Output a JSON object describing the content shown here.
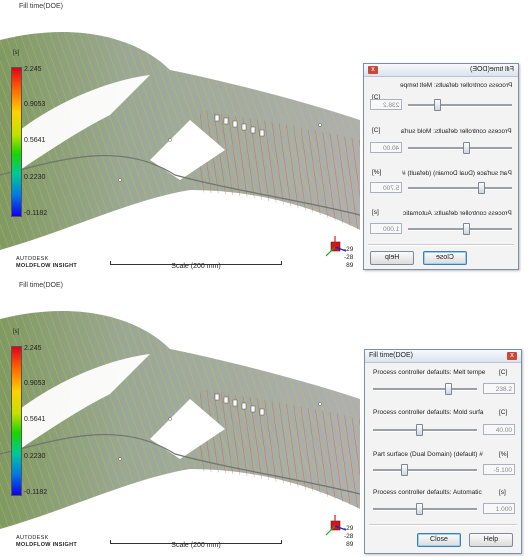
{
  "view": {
    "title": "Fill time(DOE)",
    "legend": {
      "unit": "[s]",
      "labels": [
        "2.245",
        "0.9053",
        "0.5641",
        "0.2230",
        "-0.1182"
      ]
    },
    "brand": {
      "line1": "AUTODESK",
      "line2": "MOLDFLOW INSIGHT"
    },
    "scale_label": "Scale (200 mm)",
    "coords": [
      "-29",
      "-28",
      "89"
    ]
  },
  "dialog": {
    "title": "Fill time(DOE)",
    "close_glyph": "x",
    "params": [
      {
        "label": "Process controller defaults: Melt tempe",
        "unit": "[C]",
        "value": "238.2",
        "slider_fraction": 0.72
      },
      {
        "label": "Process controller defaults: Mold surfa",
        "unit": "[C]",
        "value": "40.00",
        "slider_fraction": 0.44
      },
      {
        "label": "Part surface (Dual Domain) (default) #",
        "unit": "[%]",
        "value": "-5.100",
        "slider_fraction": 0.3
      },
      {
        "label": "Process controller defaults: Automatic",
        "unit": "[s]",
        "value": "1.000",
        "slider_fraction": 0.44
      }
    ],
    "close_label": "Close",
    "help_label": "Help"
  },
  "top_dialog_mirrored": {
    "params": [
      {
        "label": "Process controller defaults: Melt tempe",
        "unit": "[C]",
        "value": "238.2",
        "slider_fraction": 0.72
      },
      {
        "label": "Process controller defaults: Mold surfa",
        "unit": "[C]",
        "value": "40.00",
        "slider_fraction": 0.44
      },
      {
        "label": "Part surface (Dual Domain) (default) #",
        "unit": "[%]",
        "value": "5.700",
        "slider_fraction": 0.3
      },
      {
        "label": "Process controller defaults: Automatic",
        "unit": "[s]",
        "value": "1.000",
        "slider_fraction": 0.44
      }
    ]
  },
  "colors": {
    "part_gray": "#8f9490",
    "contour_yellow": "#d8c23c",
    "contour_red": "#d1412f",
    "dialog_border": "#7f8ea5"
  }
}
